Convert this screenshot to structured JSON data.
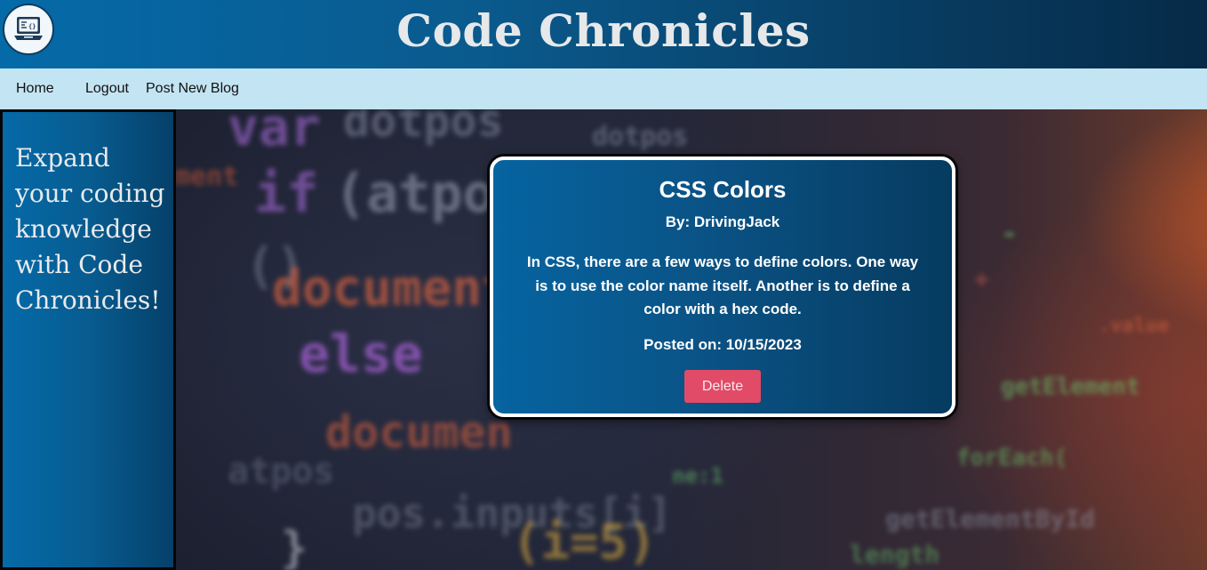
{
  "header": {
    "title": "Code Chronicles",
    "logo_icon": "laptop-code-icon"
  },
  "nav": {
    "home": "Home",
    "logout": "Logout",
    "post_new_blog": "Post New Blog"
  },
  "sidebar": {
    "tagline": "Expand your coding knowledge with Code Chronicles!"
  },
  "post": {
    "title": "CSS Colors",
    "author": "By: DrivingJack",
    "body": "In CSS, there are a few ways to define colors. One way is to use the color name itself. Another is to define a color with a hex code.",
    "posted": "Posted on: 10/15/2023",
    "delete_label": "Delete"
  },
  "colors": {
    "header_start": "#056aa8",
    "header_end": "#062a47",
    "nav_bg": "#c3e4f3",
    "delete_button": "#e14b67"
  }
}
